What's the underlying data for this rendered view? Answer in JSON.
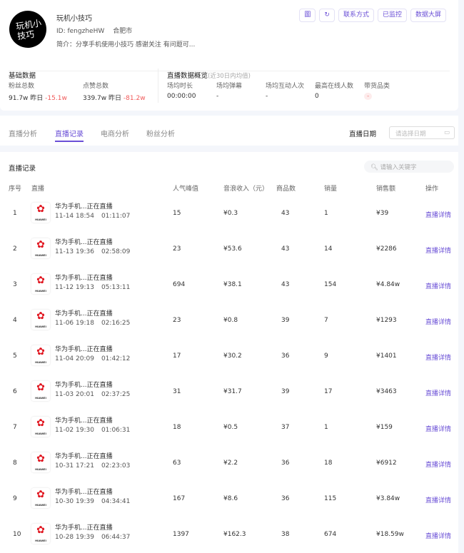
{
  "profile": {
    "avatar_text": "玩机小技巧",
    "name": "玩机小技巧",
    "id": "ID: fengzheHW",
    "city": "合肥市",
    "bio": "简介：分享手机使用小技巧 感谢关注 有问题可..."
  },
  "actions": {
    "b1": "圖",
    "b2": "↻",
    "contact": "联系方式",
    "monitored": "已监控",
    "bigscreen": "数据大屏"
  },
  "basic": {
    "title": "基础数据",
    "fans_label": "粉丝总数",
    "fans": "91.7w",
    "fans_y": "昨日",
    "fans_d": "-15.1w",
    "likes_label": "点赞总数",
    "likes": "339.7w",
    "likes_y": "昨日",
    "likes_d": "-81.2w"
  },
  "live_overview": {
    "title": "直播数据概览",
    "note": "(近30日内均值)",
    "labels": [
      "场均时长",
      "场均弹幕",
      "场均互动人次",
      "最高在线人数",
      "带货品类"
    ],
    "values": [
      "00:00:00",
      "-",
      "-",
      "0",
      "-"
    ]
  },
  "tabs": [
    "直播分析",
    "直播记录",
    "电商分析",
    "粉丝分析"
  ],
  "date": {
    "label": "直播日期",
    "placeholder": "请选择日期"
  },
  "list": {
    "title": "直播记录",
    "search_placeholder": "请输入关键字",
    "headers": [
      "序号",
      "直播",
      "人气峰值",
      "音浪收入（元）",
      "商品数",
      "销量",
      "销售额",
      "操作"
    ],
    "rows": [
      {
        "n": "1",
        "title": "华为手机...正在直播",
        "date": "11-14 18:54",
        "dur": "01:11:07",
        "peak": "15",
        "income": "¥0.3",
        "goods": "43",
        "sales": "1",
        "amount": "¥39",
        "op": "直播详情"
      },
      {
        "n": "2",
        "title": "华为手机...正在直播",
        "date": "11-13 19:36",
        "dur": "02:58:09",
        "peak": "23",
        "income": "¥53.6",
        "goods": "43",
        "sales": "14",
        "amount": "¥2286",
        "op": "直播详情"
      },
      {
        "n": "3",
        "title": "华为手机...正在直播",
        "date": "11-12 19:13",
        "dur": "05:13:11",
        "peak": "694",
        "income": "¥38.1",
        "goods": "43",
        "sales": "154",
        "amount": "¥4.84w",
        "op": "直播详情"
      },
      {
        "n": "4",
        "title": "华为手机...正在直播",
        "date": "11-06 19:18",
        "dur": "02:16:25",
        "peak": "23",
        "income": "¥0.8",
        "goods": "39",
        "sales": "7",
        "amount": "¥1293",
        "op": "直播详情"
      },
      {
        "n": "5",
        "title": "华为手机...正在直播",
        "date": "11-04 20:09",
        "dur": "01:42:12",
        "peak": "17",
        "income": "¥30.2",
        "goods": "36",
        "sales": "9",
        "amount": "¥1401",
        "op": "直播详情"
      },
      {
        "n": "6",
        "title": "华为手机...正在直播",
        "date": "11-03 20:01",
        "dur": "02:37:25",
        "peak": "31",
        "income": "¥31.7",
        "goods": "39",
        "sales": "17",
        "amount": "¥3463",
        "op": "直播详情"
      },
      {
        "n": "7",
        "title": "华为手机...正在直播",
        "date": "11-02 19:30",
        "dur": "01:06:31",
        "peak": "18",
        "income": "¥0.5",
        "goods": "37",
        "sales": "1",
        "amount": "¥159",
        "op": "直播详情"
      },
      {
        "n": "8",
        "title": "华为手机...正在直播",
        "date": "10-31 17:21",
        "dur": "02:23:03",
        "peak": "63",
        "income": "¥2.2",
        "goods": "36",
        "sales": "18",
        "amount": "¥6912",
        "op": "直播详情"
      },
      {
        "n": "9",
        "title": "华为手机...正在直播",
        "date": "10-30 19:39",
        "dur": "04:34:41",
        "peak": "167",
        "income": "¥8.6",
        "goods": "36",
        "sales": "115",
        "amount": "¥3.84w",
        "op": "直播详情"
      },
      {
        "n": "10",
        "title": "华为手机...正在直播",
        "date": "10-28 19:39",
        "dur": "06:44:37",
        "peak": "1397",
        "income": "¥162.3",
        "goods": "38",
        "sales": "674",
        "amount": "¥18.59w",
        "op": "直播详情"
      }
    ]
  },
  "logo_text": "HUAWEI"
}
